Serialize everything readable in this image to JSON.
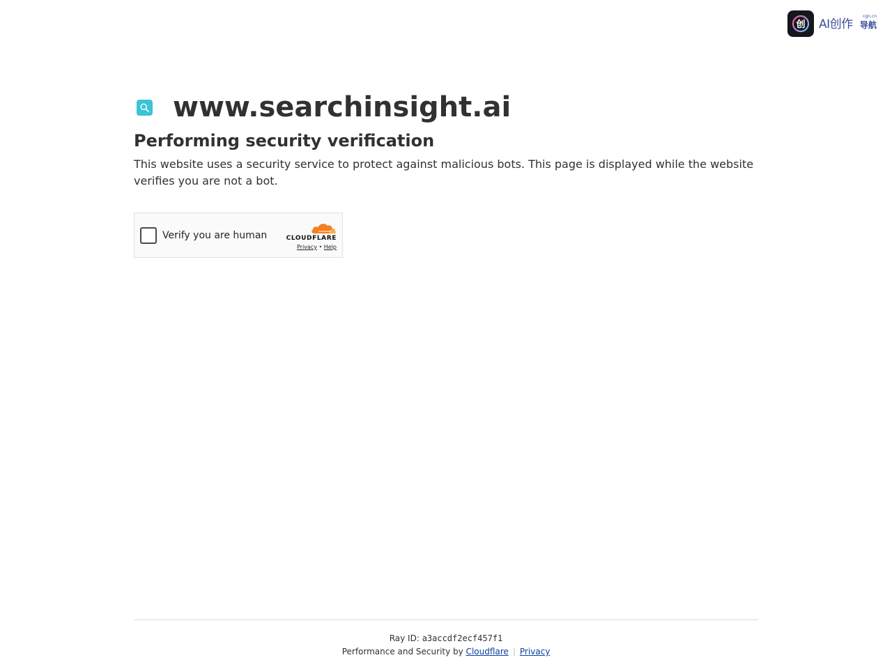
{
  "brand": {
    "icon": "brand-logo-icon",
    "main_text": "AI创作",
    "sub_text": "导航",
    "domain_text": "cgn.cn"
  },
  "site": {
    "favicon": "search-icon",
    "domain": "www.searchinsight.ai",
    "favicon_color": "#3cc3d6"
  },
  "page": {
    "heading": "Performing security verification",
    "description": "This website uses a security service to protect against malicious bots. This page is displayed while the website verifies you are not a bot."
  },
  "widget": {
    "checkbox_label": "Verify you are human",
    "checked": false,
    "provider_wordmark": "CLOUDFLARE",
    "privacy_link": "Privacy",
    "link_separator": "•",
    "help_link": "Help",
    "cloud_colors": [
      "#f38020",
      "#faae40"
    ]
  },
  "footer": {
    "ray_label": "Ray ID: ",
    "ray_id": "a3accdf2ecf457f1",
    "perf_prefix": "Performance and Security by ",
    "cloudflare_link": "Cloudflare",
    "separator": "|",
    "privacy_link": "Privacy",
    "link_color": "#0a3fa0"
  }
}
